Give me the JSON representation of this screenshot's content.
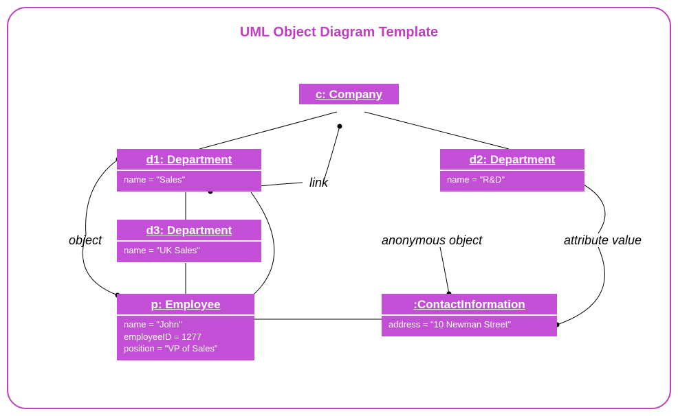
{
  "title": "UML Object Diagram Template",
  "annotations": {
    "link": "link",
    "object": "object",
    "anonymous": "anonymous object",
    "attrvalue": "attribute value"
  },
  "objects": {
    "company": {
      "head": "c: Company",
      "attrs": []
    },
    "d1": {
      "head": "d1: Department",
      "attrs": [
        "name = \"Sales\""
      ]
    },
    "d2": {
      "head": "d2: Department",
      "attrs": [
        "name = \"R&D\""
      ]
    },
    "d3": {
      "head": "d3: Department",
      "attrs": [
        "name = \"UK Sales\""
      ]
    },
    "p": {
      "head": "p: Employee",
      "attrs": [
        "name = \"John\"",
        "employeeID = 1277",
        "position = \"VP of Sales\""
      ]
    },
    "ci": {
      "head": ":ContactInformation",
      "attrs": [
        "address = \"10 Newman Street\""
      ]
    }
  }
}
